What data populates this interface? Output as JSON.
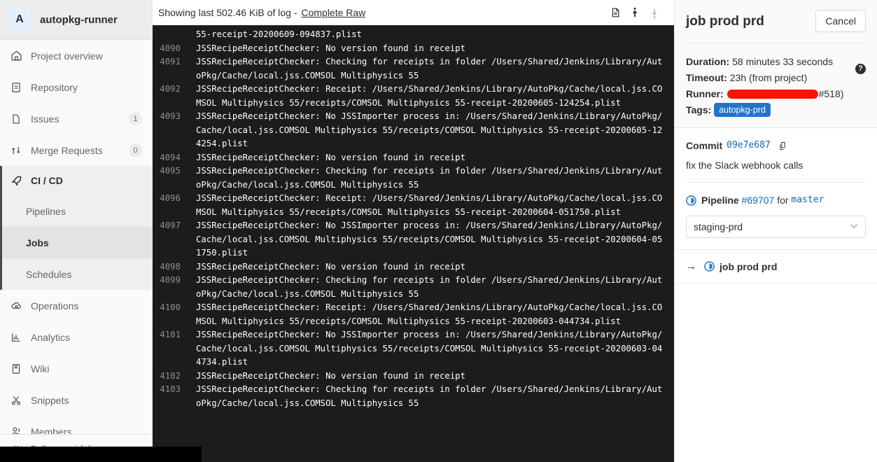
{
  "sidebar": {
    "project": {
      "initial": "A",
      "name": "autopkg-runner"
    },
    "items": [
      {
        "label": "Project overview",
        "icon": "home-icon",
        "count": null
      },
      {
        "label": "Repository",
        "icon": "document-icon",
        "count": null
      },
      {
        "label": "Issues",
        "icon": "issues-icon",
        "count": "1"
      },
      {
        "label": "Merge Requests",
        "icon": "merge-request-icon",
        "count": "0"
      }
    ],
    "cicd": {
      "label": "CI / CD",
      "icon": "rocket-icon",
      "sub": [
        {
          "label": "Pipelines",
          "active": false
        },
        {
          "label": "Jobs",
          "active": true
        },
        {
          "label": "Schedules",
          "active": false
        }
      ]
    },
    "items_after": [
      {
        "label": "Operations",
        "icon": "cloud-gear-icon",
        "count": null
      },
      {
        "label": "Analytics",
        "icon": "chart-icon",
        "count": null
      },
      {
        "label": "Wiki",
        "icon": "book-icon",
        "count": null
      },
      {
        "label": "Snippets",
        "icon": "scissors-icon",
        "count": null
      },
      {
        "label": "Members",
        "icon": "members-icon",
        "count": null
      }
    ],
    "collapse": {
      "label": "Collapse sidebar",
      "icon": "double-chevron-left-icon"
    }
  },
  "log_header": {
    "showing_text": "Showing last 502.46 KiB of log - ",
    "raw_link": "Complete Raw",
    "icons": [
      {
        "name": "raw-log-icon",
        "state": "enabled"
      },
      {
        "name": "scroll-to-top-icon",
        "state": "enabled"
      },
      {
        "name": "scroll-to-bottom-icon",
        "state": "disabled"
      }
    ]
  },
  "log": {
    "lines": [
      {
        "num": "",
        "text": "55-receipt-20200609-094837.plist",
        "cont": true
      },
      {
        "num": "4090",
        "text": "JSSRecipeReceiptChecker: No version found in receipt",
        "cont": false
      },
      {
        "num": "4091",
        "text": "JSSRecipeReceiptChecker: Checking for receipts in folder /Users/Shared/Jenkins/Library/AutoPkg/Cache/local.jss.COMSOL Multiphysics 55",
        "cont": false
      },
      {
        "num": "4092",
        "text": "JSSRecipeReceiptChecker: Receipt: /Users/Shared/Jenkins/Library/AutoPkg/Cache/local.jss.COMSOL Multiphysics 55/receipts/COMSOL Multiphysics 55-receipt-20200605-124254.plist",
        "cont": false
      },
      {
        "num": "4093",
        "text": "JSSRecipeReceiptChecker: No JSSImporter process in: /Users/Shared/Jenkins/Library/AutoPkg/Cache/local.jss.COMSOL Multiphysics 55/receipts/COMSOL Multiphysics 55-receipt-20200605-124254.plist",
        "cont": false
      },
      {
        "num": "4094",
        "text": "JSSRecipeReceiptChecker: No version found in receipt",
        "cont": false
      },
      {
        "num": "4095",
        "text": "JSSRecipeReceiptChecker: Checking for receipts in folder /Users/Shared/Jenkins/Library/AutoPkg/Cache/local.jss.COMSOL Multiphysics 55",
        "cont": false
      },
      {
        "num": "4096",
        "text": "JSSRecipeReceiptChecker: Receipt: /Users/Shared/Jenkins/Library/AutoPkg/Cache/local.jss.COMSOL Multiphysics 55/receipts/COMSOL Multiphysics 55-receipt-20200604-051750.plist",
        "cont": false
      },
      {
        "num": "4097",
        "text": "JSSRecipeReceiptChecker: No JSSImporter process in: /Users/Shared/Jenkins/Library/AutoPkg/Cache/local.jss.COMSOL Multiphysics 55/receipts/COMSOL Multiphysics 55-receipt-20200604-051750.plist",
        "cont": false
      },
      {
        "num": "4098",
        "text": "JSSRecipeReceiptChecker: No version found in receipt",
        "cont": false
      },
      {
        "num": "4099",
        "text": "JSSRecipeReceiptChecker: Checking for receipts in folder /Users/Shared/Jenkins/Library/AutoPkg/Cache/local.jss.COMSOL Multiphysics 55",
        "cont": false
      },
      {
        "num": "4100",
        "text": "JSSRecipeReceiptChecker: Receipt: /Users/Shared/Jenkins/Library/AutoPkg/Cache/local.jss.COMSOL Multiphysics 55/receipts/COMSOL Multiphysics 55-receipt-20200603-044734.plist",
        "cont": false
      },
      {
        "num": "4101",
        "text": "JSSRecipeReceiptChecker: No JSSImporter process in: /Users/Shared/Jenkins/Library/AutoPkg/Cache/local.jss.COMSOL Multiphysics 55/receipts/COMSOL Multiphysics 55-receipt-20200603-044734.plist",
        "cont": false
      },
      {
        "num": "4102",
        "text": "JSSRecipeReceiptChecker: No version found in receipt",
        "cont": false
      },
      {
        "num": "4103",
        "text": "JSSRecipeReceiptChecker: Checking for receipts in folder /Users/Shared/Jenkins/Library/AutoPkg/Cache/local.jss.COMSOL Multiphysics 55",
        "cont": false
      }
    ]
  },
  "right_panel": {
    "title": "job prod prd",
    "cancel_label": "Cancel",
    "duration_label": "Duration:",
    "duration_value": "58 minutes 33 seconds",
    "timeout_label": "Timeout:",
    "timeout_value": "23h (from project)",
    "runner_label": "Runner:",
    "runner_value_redacted": true,
    "runner_value_suffix": "#518)",
    "tags_label": "Tags:",
    "tags": [
      "autopkg-prd"
    ],
    "commit_label": "Commit",
    "commit_sha": "09e7e687",
    "commit_message": "fix the Slack webhook calls",
    "pipeline_label": "Pipeline",
    "pipeline_id": "#69707",
    "pipeline_for": "for",
    "pipeline_branch": "master",
    "stage_selected": "staging-prd",
    "job_arrow": "→",
    "job_name": "job prod prd"
  },
  "colors": {
    "accent_blue": "#1f75cb",
    "link_blue": "#1068bf",
    "redaction_red": "#fb1303",
    "log_bg": "#1c1c1c",
    "sidebar_bg": "#fafafa"
  }
}
